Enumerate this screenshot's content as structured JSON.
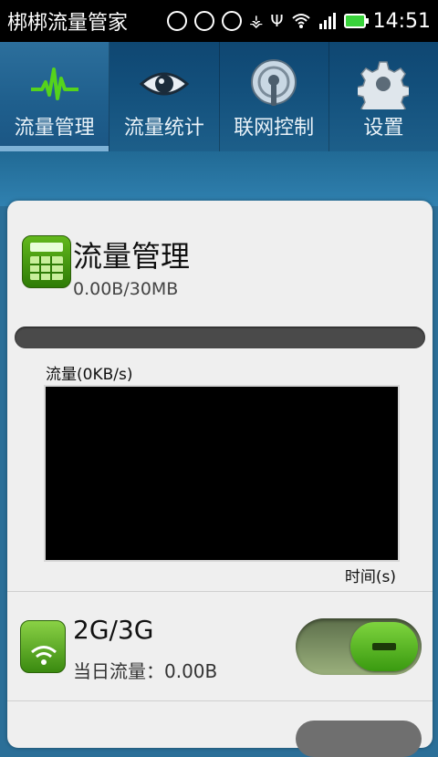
{
  "status_bar": {
    "app_title": "梆梆流量管家",
    "time": "14:51",
    "icons": [
      "notification-icon",
      "stop-icon",
      "check-icon",
      "usb-icon",
      "usb-debug-icon",
      "wifi-icon",
      "signal-icon",
      "battery-icon"
    ]
  },
  "tabs": [
    {
      "label": "流量管理",
      "icon": "pulse-icon",
      "active": true
    },
    {
      "label": "流量统计",
      "icon": "eye-icon",
      "active": false
    },
    {
      "label": "联网控制",
      "icon": "broadcast-icon",
      "active": false
    },
    {
      "label": "设置",
      "icon": "gear-icon",
      "active": false
    }
  ],
  "traffic": {
    "title": "流量管理",
    "usage": "0.00B/30MB",
    "used_fraction": 0.0,
    "graph_label": "流量(0KB/s)",
    "time_label": "时间(s)"
  },
  "network_2g3g": {
    "title": "2G/3G",
    "daily_usage": "当日流量：0.00B",
    "enabled": true
  },
  "next_item": {
    "label": ""
  }
}
